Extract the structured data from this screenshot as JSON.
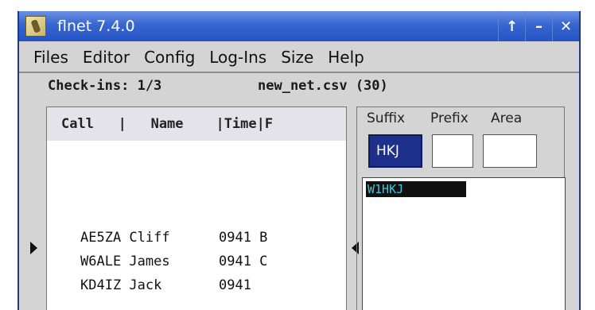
{
  "window": {
    "title": "flnet 7.4.0"
  },
  "menu": {
    "files": "Files",
    "editor": "Editor",
    "config": "Config",
    "logins": "Log-Ins",
    "size": "Size",
    "help": "Help"
  },
  "status": {
    "checkins": "Check-ins: 1/3",
    "net_file": "new_net.csv (30)"
  },
  "callsign_list": {
    "header": "Call   |   Name    |Time|F",
    "rows": [
      "AE5ZA Cliff      0941 B",
      "W6ALE James      0941 C",
      "KD4IZ Jack       0941"
    ]
  },
  "lookup": {
    "suffix_label": "Suffix",
    "prefix_label": "Prefix",
    "area_label": "Area",
    "suffix_value": "HKJ",
    "prefix_value": "",
    "area_value": ""
  },
  "matches": {
    "selected": "W1HKJ"
  },
  "colors": {
    "titlebar": "#2553c4",
    "suffix_bg": "#1f2f8c",
    "match_text": "#37c9e0"
  }
}
